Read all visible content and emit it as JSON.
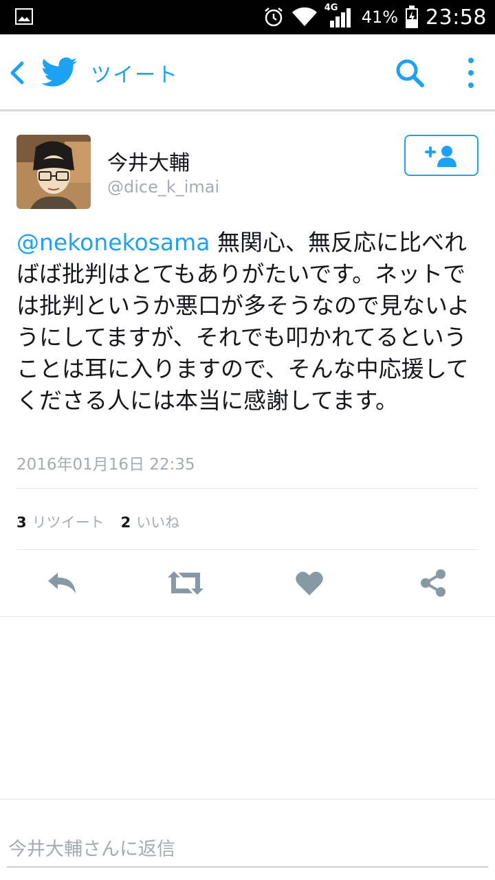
{
  "status_bar": {
    "network_label": "4G",
    "battery_percent": "41%",
    "time": "23:58"
  },
  "app_bar": {
    "title": "ツイート"
  },
  "tweet": {
    "author_name": "今井大輔",
    "author_handle": "@dice_k_imai",
    "mention": "@nekonekosama",
    "body": " 無関心、無反応に比べればば批判はとてもありがたいです。ネットでは批判というか悪口が多そうなので見ないようにしてますが、それでも叩かれてるということは耳に入りますので、そんな中応援してくださる人には本当に感謝してます。",
    "timestamp": "2016年01月16日 22:35",
    "retweet_count": "3",
    "retweet_label": "リツイート",
    "like_count": "2",
    "like_label": "いいね"
  },
  "reply": {
    "placeholder": "今井大輔さんに返信"
  },
  "colors": {
    "accent": "#1da1f2",
    "muted": "#a3abb3",
    "icon_gray": "#8899a6"
  },
  "icons": [
    "image-icon",
    "alarm-icon",
    "wifi-icon",
    "signal-icon",
    "battery-icon",
    "back-icon",
    "twitter-bird-icon",
    "search-icon",
    "more-vert-icon",
    "follow-add-user-icon",
    "reply-icon",
    "retweet-icon",
    "heart-icon",
    "share-icon"
  ]
}
